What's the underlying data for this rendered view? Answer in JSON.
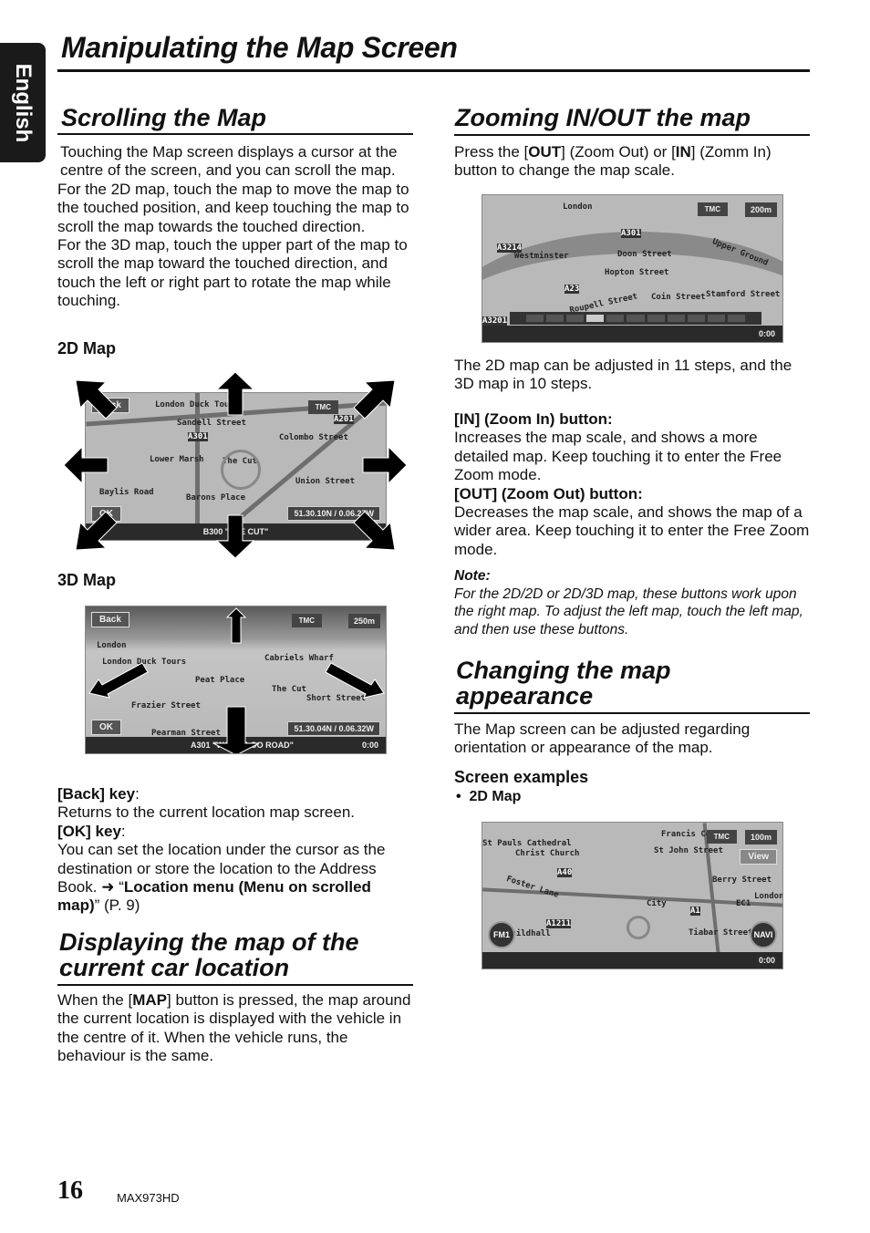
{
  "side_tab": "English",
  "title": "Manipulating the Map Screen",
  "scrolling": {
    "heading": "Scrolling the Map",
    "paragraphs": [
      "Touching the Map screen displays a cursor at the centre of the screen, and you can scroll the map.",
      "For the 2D map, touch the map to move the map to the touched position, and keep touching the map to scroll the map towards the touched direction.",
      "For the 3D map, touch the upper part of the map to scroll the map toward the touched direction, and touch the left or right part to rotate the map while touching."
    ],
    "map2d_label": "2D Map",
    "map2d": {
      "back": "Back",
      "ok": "OK",
      "coord": "51.30.10N / 0.06.27W",
      "road": "B300 \"THE CUT\"",
      "tmc": "TMC",
      "labels": [
        "London Duck Tours",
        "Sandell Street",
        "Colombo Street",
        "A301",
        "A201",
        "Lower Marsh",
        "The Cut",
        "Baylis Road",
        "Union Street",
        "Barons Place"
      ]
    },
    "map3d_label": "3D Map",
    "map3d": {
      "back": "Back",
      "ok": "OK",
      "coord": "51.30.04N / 0.06.32W",
      "road": "A301 \"WATERLOO ROAD\"",
      "time": "0:00",
      "scale": "250m",
      "tmc": "TMC",
      "labels": [
        "London",
        "London Duck Tours",
        "Cabriels Wharf",
        "Peat Place",
        "The Cut",
        "Short Street",
        "Frazier Street",
        "Pearman Street"
      ]
    },
    "back_key_label": "[Back] key",
    "back_key_text": "Returns to the current location map screen.",
    "ok_key_label": "[OK] key",
    "ok_key_text": "You can set the location under the cursor as the destination or store the location to the Address Book.",
    "ok_key_ref_arrow": "➜",
    "ok_key_ref": "Location menu (Menu on scrolled map)",
    "ok_key_page": "(P. 9)"
  },
  "displaying": {
    "heading": "Displaying the map of the current car location",
    "text_pre": "When the [",
    "text_bold": "MAP",
    "text_post": "] button is pressed, the map around the current location is displayed with the vehicle in the centre of it. When the vehicle runs, the behaviour is the same."
  },
  "zooming": {
    "heading": "Zooming IN/OUT the map",
    "intro_1": "Press the [",
    "intro_out": "OUT",
    "intro_2": "] (Zoom Out) or [",
    "intro_in": "IN",
    "intro_3": "] (Zomm In) button to change the map scale.",
    "map": {
      "time": "0:00",
      "scale": "200m",
      "tmc": "TMC",
      "labels": [
        "London",
        "A3214",
        "Westminster",
        "A301",
        "Doon Street",
        "Hopton Street",
        "A23",
        "Upper Ground",
        "Stamford Street",
        "Coin Street",
        "A3201",
        "Roupell Street"
      ],
      "zoom_level": 4,
      "zoom_steps": 11
    },
    "steps_text": "The 2D map can be adjusted in 11 steps, and the 3D map in 10 steps.",
    "in_label": "[IN] (Zoom In) button:",
    "in_text": "Increases the map scale, and shows a more detailed map. Keep touching it to enter the Free Zoom mode.",
    "out_label": "[OUT] (Zoom Out) button:",
    "out_text": "Decreases the map scale, and shows the map of a wider area. Keep touching it to enter the Free Zoom mode.",
    "note_label": "Note:",
    "note_text": "For the 2D/2D or 2D/3D map, these buttons work upon the right map. To adjust the left map, touch the left map, and then use these buttons."
  },
  "appearance": {
    "heading": "Changing the map appearance",
    "text": "The Map screen can be adjusted regarding orientation or appearance of the map.",
    "examples_label": "Screen examples",
    "bullet": "2D Map",
    "map": {
      "fm": "FM1",
      "navi": "NAVI",
      "view": "View",
      "scale": "100m",
      "time": "0:00",
      "tmc": "TMC",
      "labels": [
        "St Pauls Cathedral",
        "Christ Church",
        "A40",
        "Foster Lane",
        "A1211",
        "Guildhall",
        "City",
        "A1",
        "EC1",
        "London",
        "Berry Street",
        "St John Street",
        "Francis Court",
        "Tiabar Street"
      ]
    }
  },
  "footer": {
    "page": "16",
    "model": "MAX973HD"
  }
}
